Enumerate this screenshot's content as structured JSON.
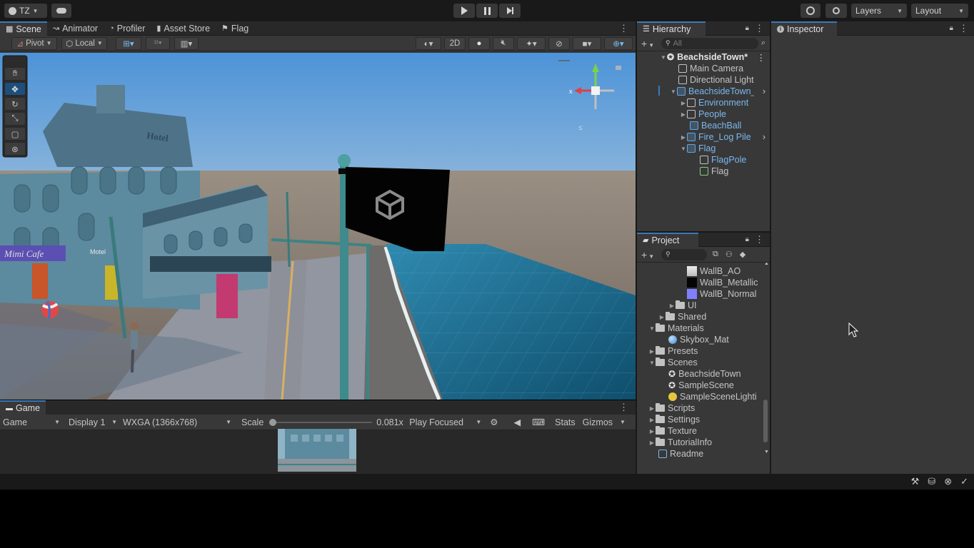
{
  "topbar": {
    "account": "TZ",
    "layers_label": "Layers",
    "layout_label": "Layout"
  },
  "scene_tabs": [
    {
      "label": "Scene",
      "icon": "grid-icon"
    },
    {
      "label": "Animator",
      "icon": "animator-icon"
    },
    {
      "label": "Profiler",
      "icon": "profiler-icon"
    },
    {
      "label": "Asset Store",
      "icon": "store-icon"
    },
    {
      "label": "Flag",
      "icon": "flag-icon"
    }
  ],
  "scene_toolbar": {
    "pivot": "Pivot",
    "local": "Local",
    "twod": "2D"
  },
  "hierarchy": {
    "title": "Hierarchy",
    "search_placeholder": "All",
    "items": [
      {
        "label": "BeachsideTown*",
        "depth": 0
      },
      {
        "label": "Main Camera",
        "depth": 1
      },
      {
        "label": "Directional Light",
        "depth": 1
      },
      {
        "label": "BeachsideTown_",
        "depth": 1
      },
      {
        "label": "Environment",
        "depth": 2
      },
      {
        "label": "People",
        "depth": 2
      },
      {
        "label": "BeachBall",
        "depth": 2
      },
      {
        "label": "Fire_Log Pile",
        "depth": 2
      },
      {
        "label": "Flag",
        "depth": 2
      },
      {
        "label": "FlagPole",
        "depth": 3
      },
      {
        "label": "Flag",
        "depth": 3
      }
    ]
  },
  "inspector": {
    "title": "Inspector"
  },
  "project": {
    "title": "Project",
    "items": [
      {
        "label": "WallB_AO"
      },
      {
        "label": "WallB_Metallic"
      },
      {
        "label": "WallB_Normal"
      },
      {
        "label": "UI"
      },
      {
        "label": "Shared"
      },
      {
        "label": "Materials"
      },
      {
        "label": "Skybox_Mat"
      },
      {
        "label": "Presets"
      },
      {
        "label": "Scenes"
      },
      {
        "label": "BeachsideTown"
      },
      {
        "label": "SampleScene"
      },
      {
        "label": "SampleSceneLighti"
      },
      {
        "label": "Scripts"
      },
      {
        "label": "Settings"
      },
      {
        "label": "Texture"
      },
      {
        "label": "TutorialInfo"
      },
      {
        "label": "Readme"
      }
    ]
  },
  "game": {
    "title": "Game",
    "mode": "Game",
    "display": "Display 1",
    "resolution": "WXGA (1366x768)",
    "scale_label": "Scale",
    "scale_value": "0.081x",
    "scale_fraction": 0.0,
    "play_mode": "Play Focused",
    "stats": "Stats",
    "gizmos": "Gizmos"
  },
  "scene_signs": {
    "cafe": "Mimi Cafe",
    "hotel": "Hotel",
    "motel": "Motel"
  },
  "colors": {
    "accent": "#3a79bb",
    "selected_text": "#7ab7f0"
  }
}
